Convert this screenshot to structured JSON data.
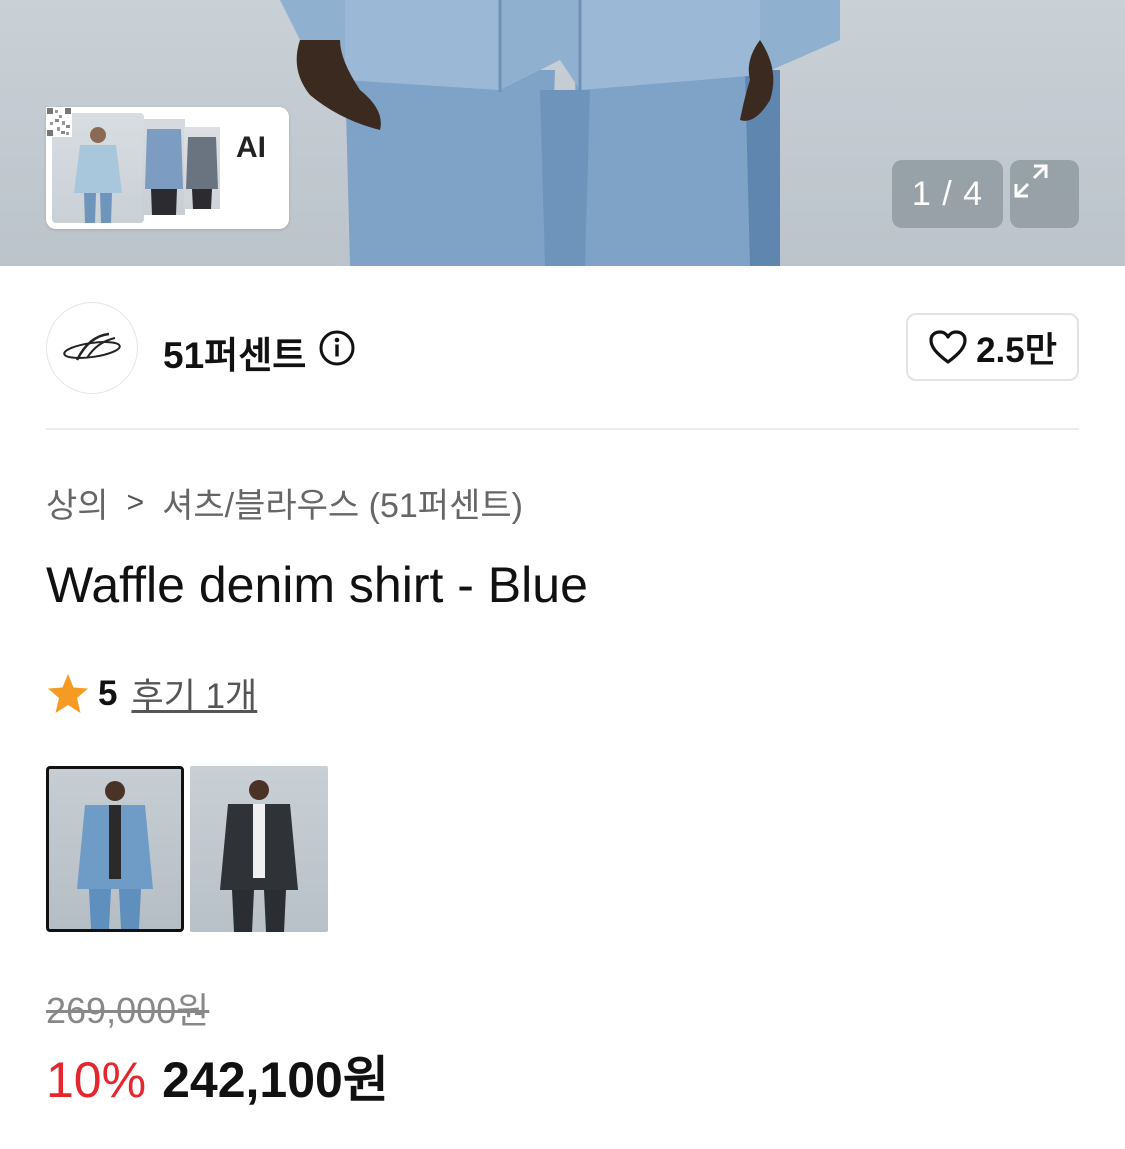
{
  "gallery": {
    "counter": "1 / 4",
    "ai_label": "AI"
  },
  "brand": {
    "name": "51퍼센트",
    "likes": "2.5만"
  },
  "breadcrumb": {
    "category": "상의",
    "subcategory": "셔츠/블라우스 (51퍼센트)"
  },
  "product": {
    "title": "Waffle denim shirt - Blue",
    "rating": "5",
    "reviews": "후기 1개",
    "original_price": "269,000원",
    "discount": "10%",
    "sale_price": "242,100원"
  },
  "colors": {
    "accent_red": "#e5262d",
    "star": "#f59a23"
  }
}
